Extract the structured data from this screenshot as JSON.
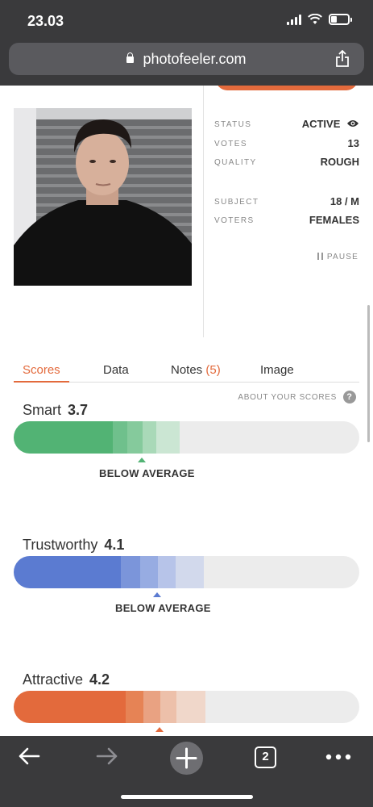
{
  "status_bar": {
    "time": "23.03"
  },
  "browser": {
    "url": "photofeeler.com",
    "open_tabs": "2"
  },
  "photo_info": {
    "rows": [
      {
        "label": "STATUS",
        "value": "ACTIVE"
      },
      {
        "label": "VOTES",
        "value": "13"
      },
      {
        "label": "QUALITY",
        "value": "ROUGH"
      },
      {
        "label": "SUBJECT",
        "value": "18 / M"
      },
      {
        "label": "VOTERS",
        "value": "FEMALES"
      }
    ],
    "pause_label": "PAUSE"
  },
  "tabs": [
    {
      "label": "Scores"
    },
    {
      "label": "Data"
    },
    {
      "label": "Notes",
      "count": "(5)"
    },
    {
      "label": "Image"
    }
  ],
  "about_scores": "ABOUT YOUR SCORES",
  "help_glyph": "?",
  "scores": [
    {
      "name": "Smart",
      "value": "3.7",
      "verdict": "BELOW AVERAGE",
      "color": "#52b374",
      "fill": 0.29
    },
    {
      "name": "Trustworthy",
      "value": "4.1",
      "verdict": "BELOW AVERAGE",
      "color": "#5b7bd1",
      "fill": 0.31
    },
    {
      "name": "Attractive",
      "value": "4.2",
      "color": "#e36a3c",
      "fill": 0.32
    }
  ]
}
